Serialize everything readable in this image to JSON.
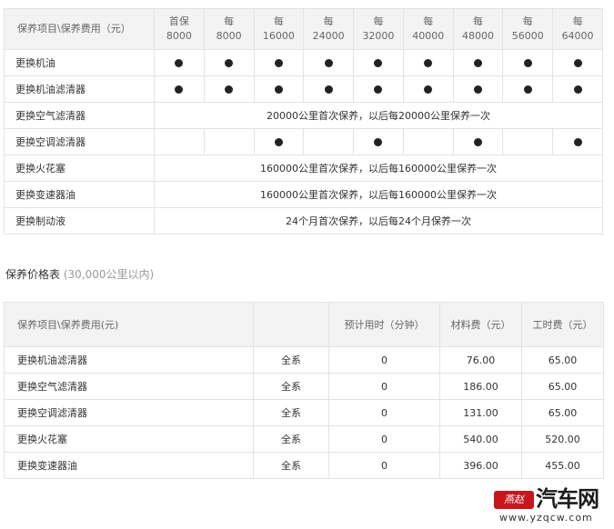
{
  "schedule": {
    "header_project": "保养项目\\保养费用（元）",
    "columns": [
      {
        "top": "首保",
        "bottom": "8000"
      },
      {
        "top": "每",
        "bottom": "8000"
      },
      {
        "top": "每",
        "bottom": "16000"
      },
      {
        "top": "每",
        "bottom": "24000"
      },
      {
        "top": "每",
        "bottom": "32000"
      },
      {
        "top": "每",
        "bottom": "40000"
      },
      {
        "top": "每",
        "bottom": "48000"
      },
      {
        "top": "每",
        "bottom": "56000"
      },
      {
        "top": "每",
        "bottom": "64000"
      }
    ],
    "rows": [
      {
        "name": "更换机油",
        "marks": [
          true,
          true,
          true,
          true,
          true,
          true,
          true,
          true,
          true
        ]
      },
      {
        "name": "更换机油滤清器",
        "marks": [
          true,
          true,
          true,
          true,
          true,
          true,
          true,
          true,
          true
        ]
      },
      {
        "name": "更换空气滤清器",
        "note": "20000公里首次保养，以后每20000公里保养一次"
      },
      {
        "name": "更换空调滤清器",
        "marks": [
          false,
          false,
          true,
          false,
          true,
          false,
          true,
          false,
          true
        ]
      },
      {
        "name": "更换火花塞",
        "note": "160000公里首次保养，以后每160000公里保养一次"
      },
      {
        "name": "更换变速器油",
        "note": "160000公里首次保养，以后每160000公里保养一次"
      },
      {
        "name": "更换制动液",
        "note": "24个月首次保养，以后每24个月保养一次"
      }
    ]
  },
  "price": {
    "title": "保养价格表",
    "subtitle": "(30,000公里以内)",
    "headers": [
      "保养项目\\保养费用(元)",
      "",
      "预计用时（分钟）",
      "材料费（元）",
      "工时费（元）"
    ],
    "rows": [
      {
        "name": "更换机油滤清器",
        "scope": "全系",
        "time": "0",
        "material": "76.00",
        "labor": "65.00"
      },
      {
        "name": "更换空气滤清器",
        "scope": "全系",
        "time": "0",
        "material": "186.00",
        "labor": "65.00"
      },
      {
        "name": "更换空调滤清器",
        "scope": "全系",
        "time": "0",
        "material": "131.00",
        "labor": "65.00"
      },
      {
        "name": "更换火花塞",
        "scope": "全系",
        "time": "0",
        "material": "540.00",
        "labor": "520.00"
      },
      {
        "name": "更换变速器油",
        "scope": "全系",
        "time": "0",
        "material": "396.00",
        "labor": "455.00"
      }
    ]
  },
  "watermark": {
    "seal": "燕赵",
    "brand": "汽车网",
    "url": "www.yzqcw.com"
  }
}
